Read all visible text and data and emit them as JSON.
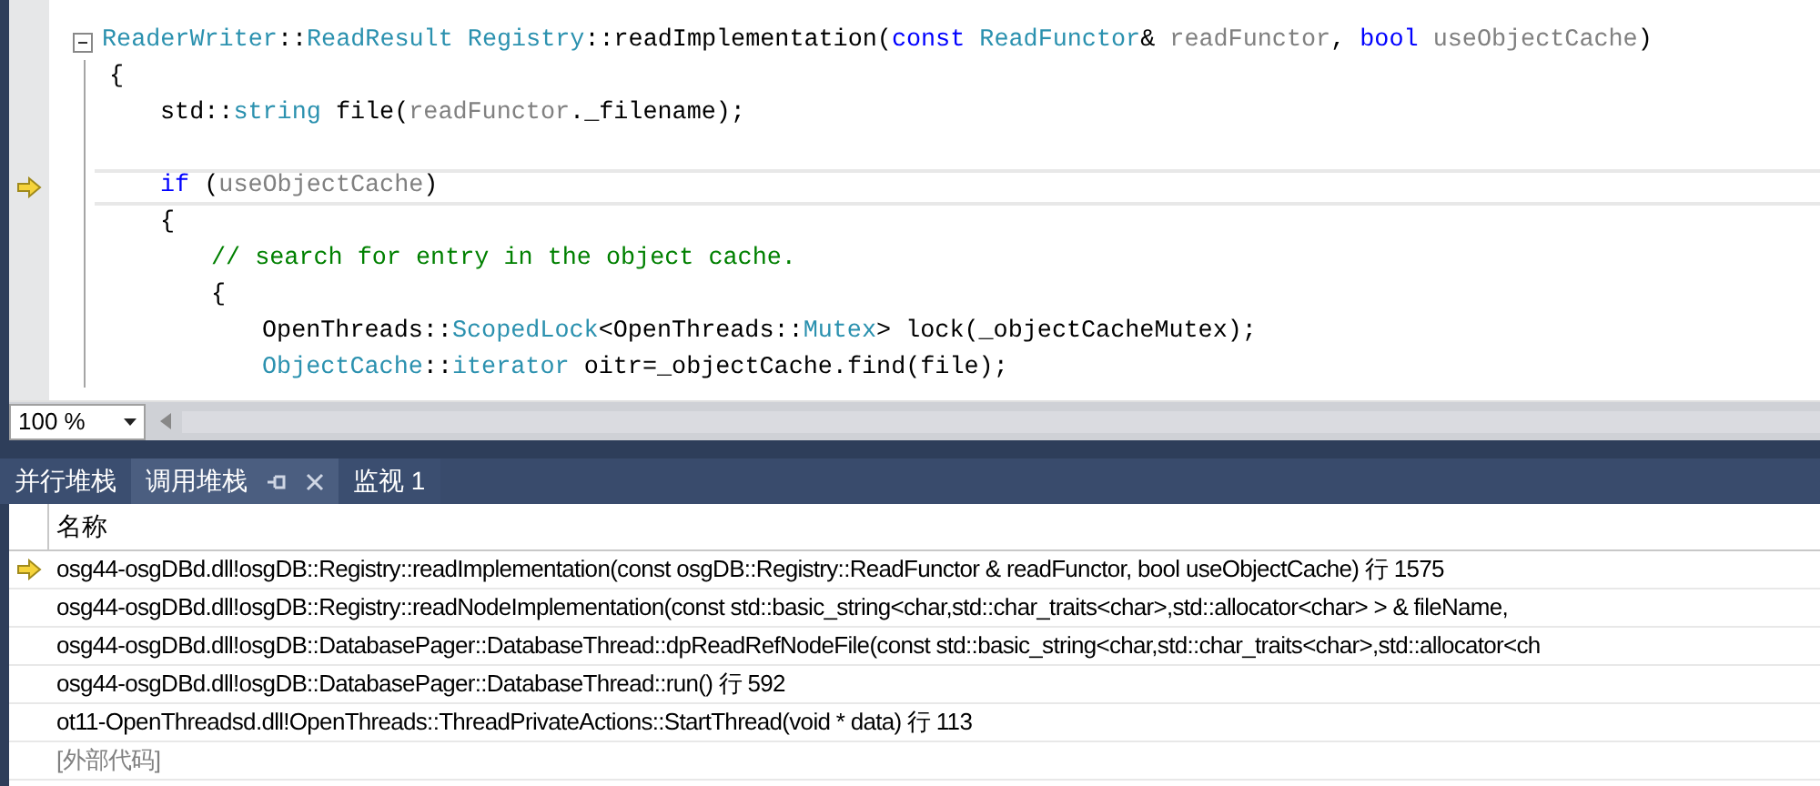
{
  "code": {
    "lines": [
      {
        "kind": "code",
        "current": false,
        "foldable": true,
        "tokens": [
          {
            "kind": "type",
            "text": "ReaderWriter"
          },
          {
            "kind": "plain",
            "text": "::"
          },
          {
            "kind": "type",
            "text": "ReadResult"
          },
          {
            "kind": "type",
            "text": " Registry"
          },
          {
            "kind": "plain",
            "text": "::readImplementation("
          },
          {
            "kind": "keyword",
            "text": "const"
          },
          {
            "kind": "type",
            "text": " ReadFunctor"
          },
          {
            "kind": "plain",
            "text": "& "
          },
          {
            "kind": "param",
            "text": "readFunctor"
          },
          {
            "kind": "plain",
            "text": ", "
          },
          {
            "kind": "keyword",
            "text": "bool"
          },
          {
            "kind": "param",
            "text": " useObjectCache"
          },
          {
            "kind": "plain",
            "text": ")"
          }
        ]
      },
      {
        "kind": "code",
        "current": false,
        "foldable": false,
        "tokens": [
          {
            "kind": "plain",
            "text": "{"
          }
        ],
        "children": [
          {
            "kind": "code",
            "current": false,
            "foldable": false,
            "tokens": [
              {
                "kind": "plain",
                "text": "std::"
              },
              {
                "kind": "type",
                "text": "string"
              },
              {
                "kind": "plain",
                "text": " file("
              },
              {
                "kind": "param",
                "text": "readFunctor"
              },
              {
                "kind": "plain",
                "text": "._filename);"
              }
            ]
          },
          {
            "kind": "blank",
            "current": false,
            "foldable": false
          },
          {
            "kind": "code",
            "current": true,
            "foldable": false,
            "tokens": [
              {
                "kind": "keyword",
                "text": "if"
              },
              {
                "kind": "plain",
                "text": " ("
              },
              {
                "kind": "param",
                "text": "useObjectCache"
              },
              {
                "kind": "plain",
                "text": ")"
              }
            ]
          },
          {
            "kind": "code",
            "current": false,
            "foldable": false,
            "tokens": [
              {
                "kind": "plain",
                "text": "{"
              }
            ],
            "children": [
              {
                "kind": "code",
                "current": false,
                "foldable": false,
                "tokens": [
                  {
                    "kind": "comment",
                    "text": "// search for entry in the object cache."
                  }
                ]
              },
              {
                "kind": "code",
                "current": false,
                "foldable": false,
                "tokens": [
                  {
                    "kind": "plain",
                    "text": "{"
                  }
                ],
                "children": [
                  {
                    "kind": "code",
                    "current": false,
                    "foldable": false,
                    "tokens": [
                      {
                        "kind": "plain",
                        "text": "OpenThreads::"
                      },
                      {
                        "kind": "type",
                        "text": "ScopedLock"
                      },
                      {
                        "kind": "plain",
                        "text": "<OpenThreads::"
                      },
                      {
                        "kind": "type",
                        "text": "Mutex"
                      },
                      {
                        "kind": "plain",
                        "text": "> lock(_objectCacheMutex);"
                      }
                    ]
                  },
                  {
                    "kind": "code",
                    "current": false,
                    "foldable": false,
                    "tokens": [
                      {
                        "kind": "type",
                        "text": "ObjectCache"
                      },
                      {
                        "kind": "plain",
                        "text": "::"
                      },
                      {
                        "kind": "type",
                        "text": "iterator"
                      },
                      {
                        "kind": "plain",
                        "text": " oitr=_objectCache.find(file);"
                      }
                    ]
                  }
                ]
              }
            ]
          }
        ]
      }
    ]
  },
  "zoom": {
    "value": "100 %"
  },
  "tabs": [
    {
      "label": "并行堆栈",
      "selected": false
    },
    {
      "label": "调用堆栈",
      "selected": true
    },
    {
      "label": "监视 1",
      "selected": false
    }
  ],
  "call_stack": {
    "columns": [
      "名称"
    ],
    "rows": [
      {
        "kind": "frame",
        "current": true,
        "name": "osg44-osgDBd.dll!osgDB::Registry::readImplementation(const osgDB::Registry::ReadFunctor & readFunctor, bool useObjectCache) 行 1575"
      },
      {
        "kind": "frame",
        "current": false,
        "name": "osg44-osgDBd.dll!osgDB::Registry::readNodeImplementation(const std::basic_string<char,std::char_traits<char>,std::allocator<char> > & fileName,"
      },
      {
        "kind": "frame",
        "current": false,
        "name": "osg44-osgDBd.dll!osgDB::DatabasePager::DatabaseThread::dpReadRefNodeFile(const std::basic_string<char,std::char_traits<char>,std::allocator<ch"
      },
      {
        "kind": "frame",
        "current": false,
        "name": "osg44-osgDBd.dll!osgDB::DatabasePager::DatabaseThread::run() 行 592"
      },
      {
        "kind": "frame",
        "current": false,
        "name": "ot11-OpenThreadsd.dll!OpenThreads::ThreadPrivateActions::StartThread(void * data) 行 113"
      },
      {
        "kind": "external",
        "current": false,
        "name": "[外部代码]"
      }
    ]
  }
}
